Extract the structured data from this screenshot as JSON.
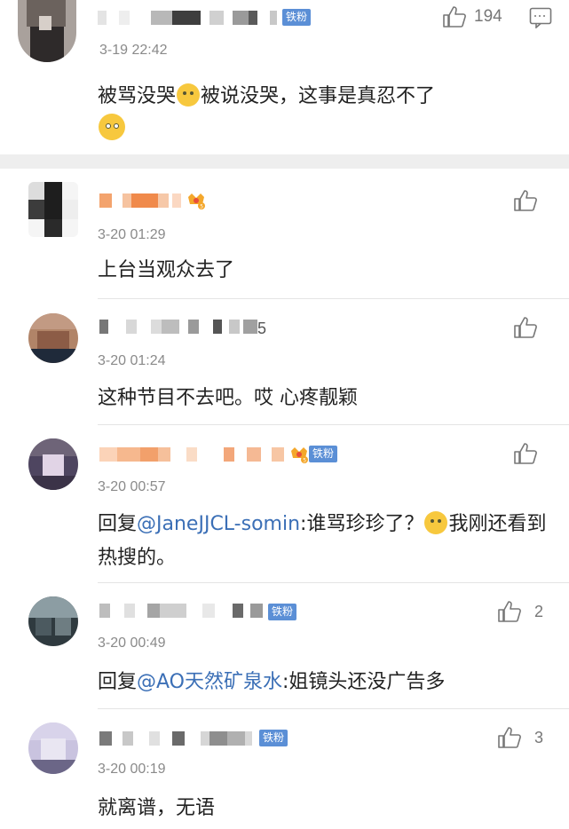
{
  "main": {
    "likes": "194",
    "timestamp": "3-19 22:42",
    "badge": "铁粉",
    "text_a": "被骂没哭",
    "text_b": "被说没哭，这事是真忍不了"
  },
  "replies": [
    {
      "timestamp": "3-20 01:29",
      "text": "上台当观众去了",
      "likes": ""
    },
    {
      "timestamp": "3-20 01:24",
      "text": "这种节目不去吧。哎 心疼靓颖",
      "likes": "",
      "name_suffix": "5"
    },
    {
      "timestamp": "3-20 00:57",
      "text_prefix": "回复",
      "mention": "@JaneJJCL-somin",
      "text_a": ":谁骂珍珍了？",
      "text_b": "我刚还看到热搜的。",
      "badge": "铁粉",
      "likes": ""
    },
    {
      "timestamp": "3-20 00:49",
      "text_prefix": "回复",
      "mention": "@AO天然矿泉水",
      "text_a": ":姐镜头还没广告多",
      "badge": "铁粉",
      "likes": "2"
    },
    {
      "timestamp": "3-20 00:19",
      "text": "就离谱，无语",
      "badge": "铁粉",
      "likes": "3"
    }
  ],
  "icons": {
    "thumb": "thumbs-up-icon",
    "comment": "comment-icon",
    "crown": "vip-crown-icon"
  },
  "colors": {
    "mention": "#3b6fb6",
    "badge": "#5b8fd6",
    "timestamp": "#8a8a8a"
  }
}
